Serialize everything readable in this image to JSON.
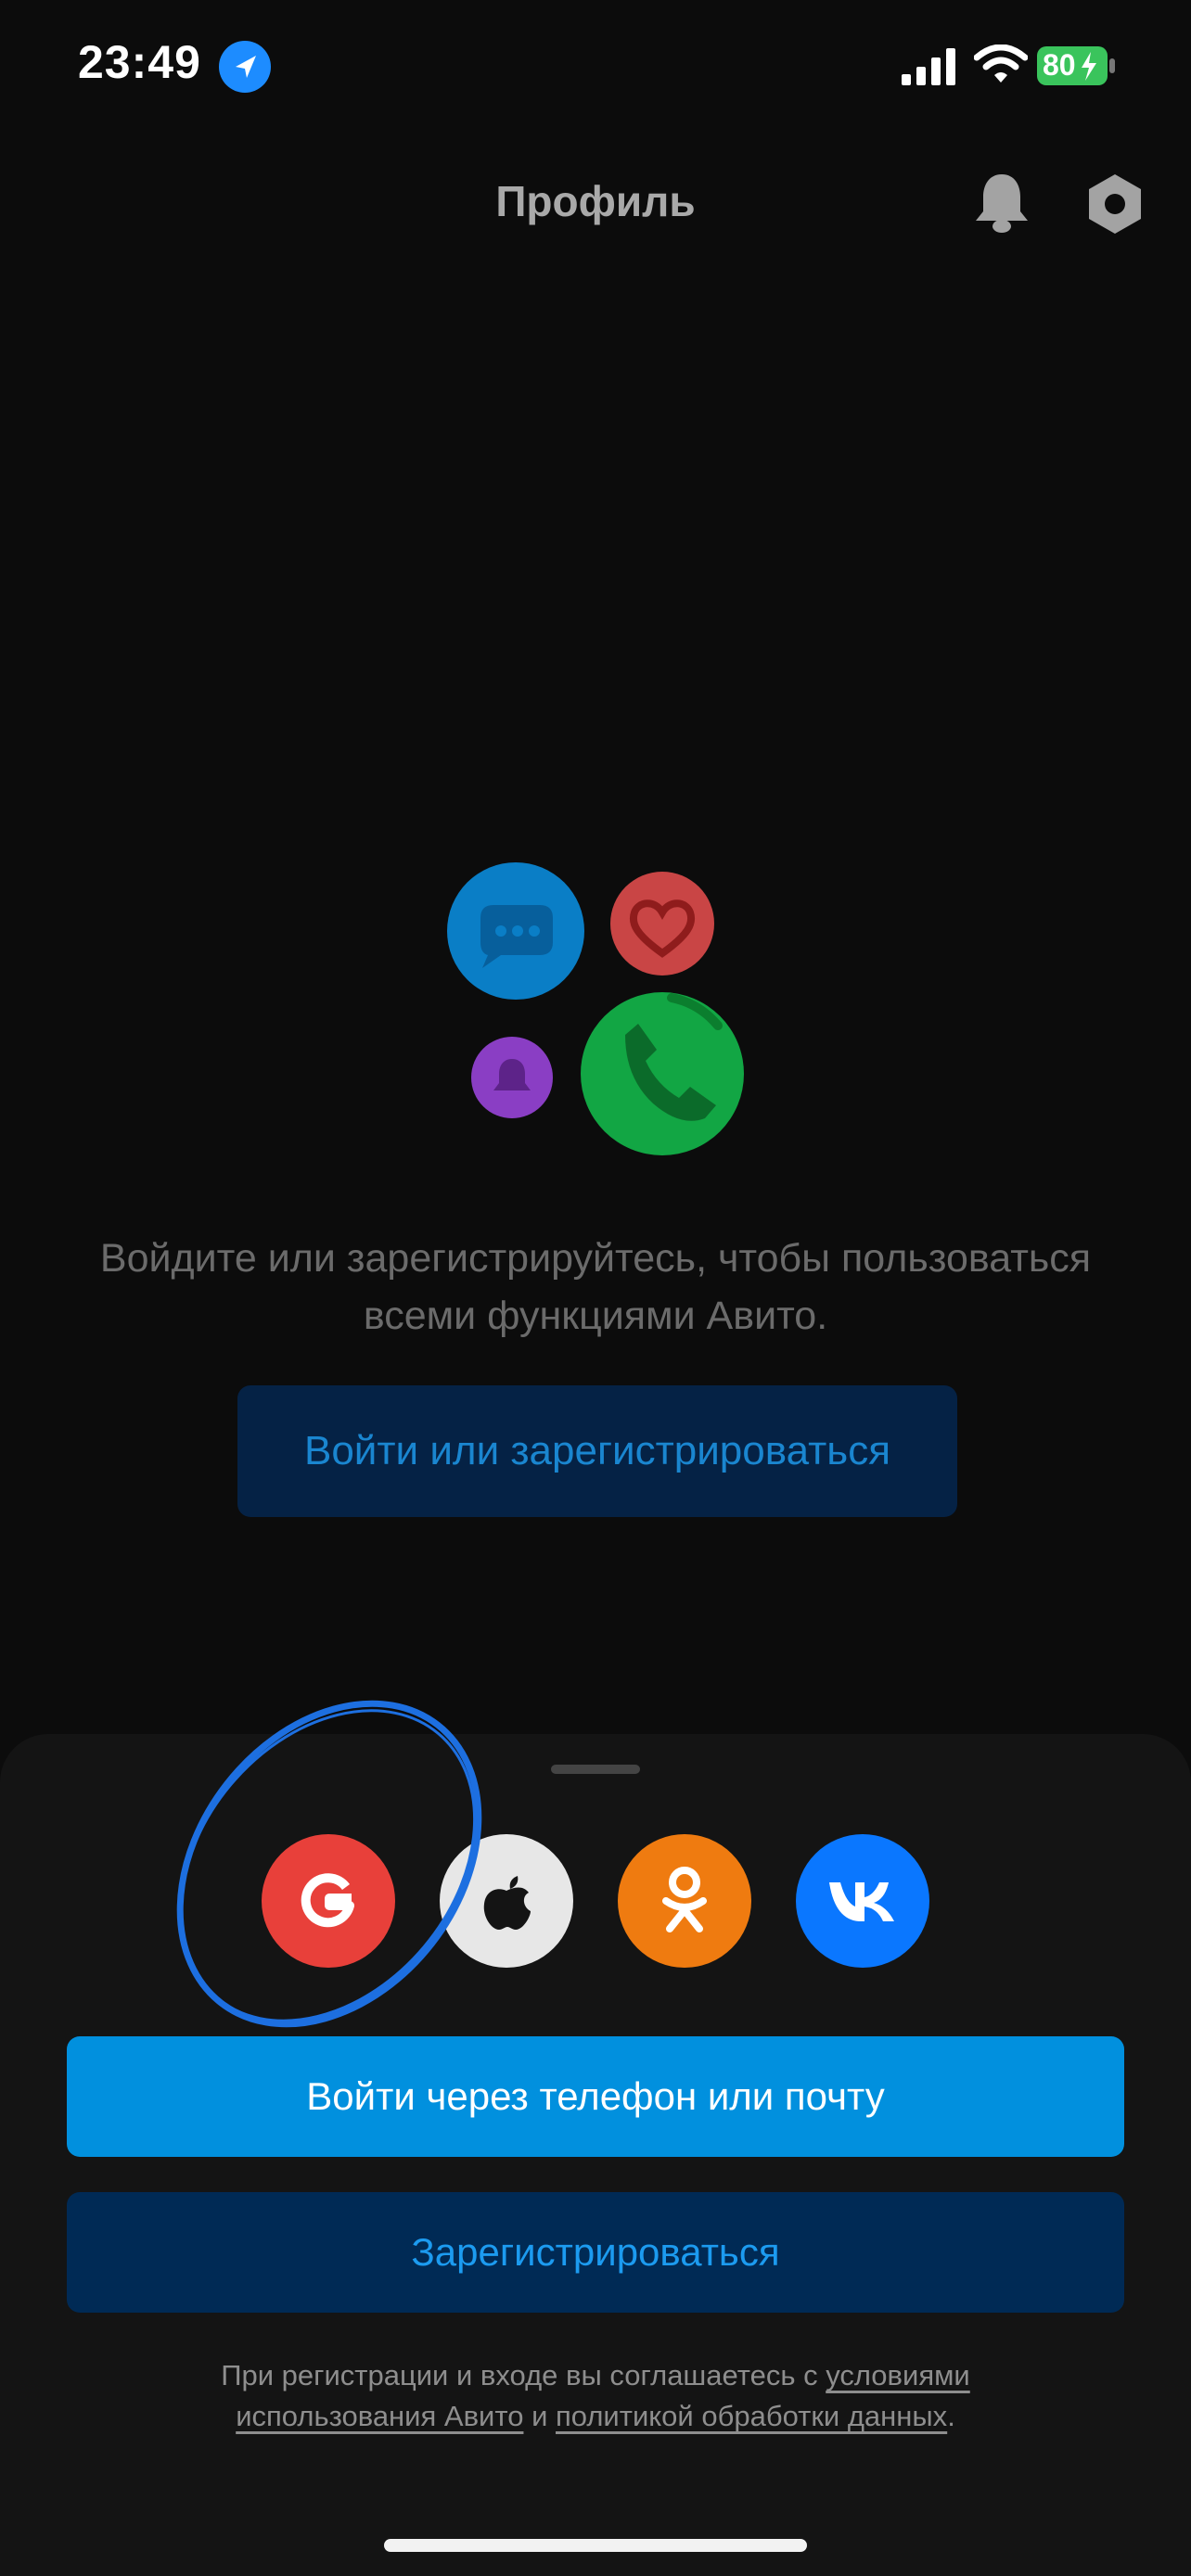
{
  "status_bar": {
    "time": "23:49",
    "battery_level": "80",
    "icons": [
      "location-icon",
      "signal-icon",
      "wifi-icon",
      "battery-icon"
    ]
  },
  "header": {
    "title": "Профиль",
    "icons": [
      "bell-icon",
      "gear-icon"
    ]
  },
  "promo": {
    "text_line1": "Войдите или зарегистрируйтесь, чтобы пользоваться",
    "text_line2": "всеми функциями Авито.",
    "button_label": "Войти или зарегистрироваться"
  },
  "sheet": {
    "social_buttons": [
      {
        "icon": "google-icon",
        "color": "#e8403a"
      },
      {
        "icon": "apple-icon",
        "color": "#e7e7e7"
      },
      {
        "icon": "odnoklassniki-icon",
        "color": "#ef7b10"
      },
      {
        "icon": "vk-icon",
        "color": "#0a77ff"
      }
    ],
    "phone_login_label": "Войти через телефон или почту",
    "register_label": "Зарегистрироваться",
    "legal": {
      "prefix": "При регистрации и входе вы соглашаетесь с ",
      "terms_line1": "условиями",
      "terms_line2": "использования Авито",
      "and": " и ",
      "privacy_link": "политикой обработки данных",
      "suffix": "."
    }
  },
  "colors": {
    "background": "#0c0c0c",
    "sheet": "#141414",
    "primary": "#0190de",
    "secondary": "#002a55",
    "highlight_circle": "#1d6fe0"
  }
}
